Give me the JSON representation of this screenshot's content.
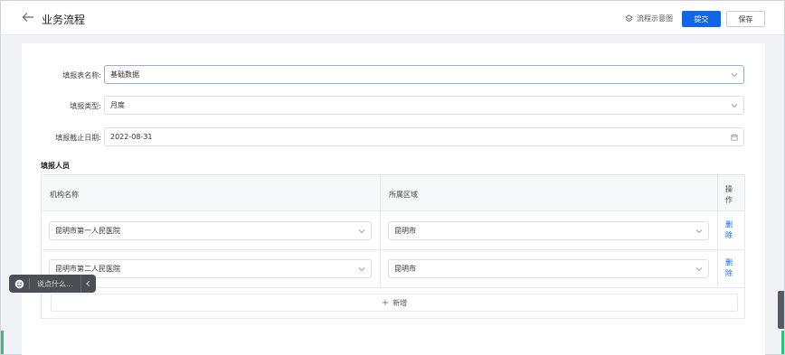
{
  "header": {
    "title": "业务流程",
    "flow_diagram_label": "流程示意图",
    "submit_label": "提交",
    "save_label": "保存"
  },
  "form": {
    "name_label": "填报表名称:",
    "name_value": "基础数据",
    "type_label": "填报类型:",
    "type_value": "月度",
    "deadline_label": "填报截止日期:",
    "deadline_value": "2022-08-31"
  },
  "people": {
    "section_title": "填报人员",
    "columns": [
      "机构名称",
      "所属区域",
      "操作"
    ],
    "rows": [
      {
        "org": "昆明市第一人民医院",
        "region": "昆明市",
        "action": "删除"
      },
      {
        "org": "昆明市第二人民医院",
        "region": "昆明市",
        "action": "删除"
      }
    ],
    "add_label": "新增"
  },
  "chat": {
    "placeholder": "说点什么..."
  },
  "colors": {
    "primary": "#1166e6",
    "accent_green": "#2ec27e"
  }
}
